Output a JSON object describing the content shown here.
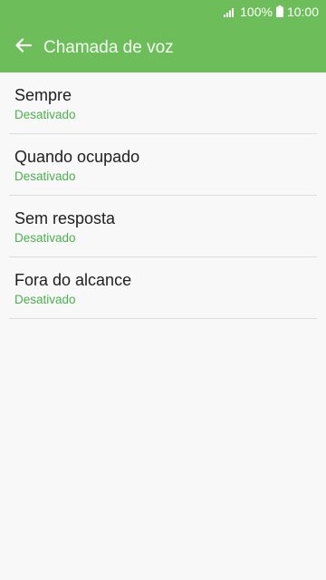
{
  "status_bar": {
    "battery_percent": "100%",
    "time": "10:00",
    "icons": [
      "signal-icon",
      "battery-icon"
    ]
  },
  "app_bar": {
    "title": "Chamada de voz",
    "back_icon": "arrow-back-icon"
  },
  "colors": {
    "accent": "#6dbe5a",
    "status_text": "#4caf50",
    "background": "#f8f8f8"
  },
  "items": [
    {
      "label": "Sempre",
      "status": "Desativado"
    },
    {
      "label": "Quando ocupado",
      "status": "Desativado"
    },
    {
      "label": "Sem resposta",
      "status": "Desativado"
    },
    {
      "label": "Fora do alcance",
      "status": "Desativado"
    }
  ]
}
